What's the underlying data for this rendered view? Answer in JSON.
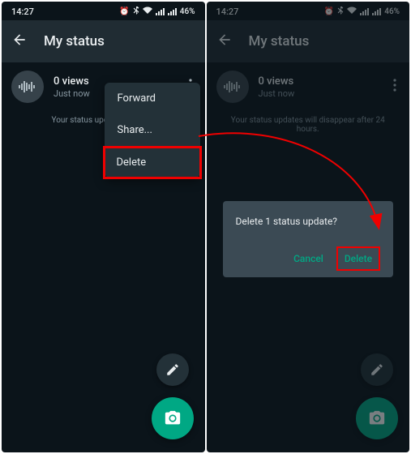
{
  "statusbar": {
    "time": "14:27",
    "battery": "46%"
  },
  "appbar": {
    "title": "My status"
  },
  "status": {
    "views": "0 views",
    "time": "Just now"
  },
  "hint_truncated": "Your status updates will disa",
  "hint_full": "Your status updates will disappear after 24 hours.",
  "menu": {
    "forward": "Forward",
    "share": "Share...",
    "delete": "Delete"
  },
  "dialog": {
    "message": "Delete 1 status update?",
    "cancel": "Cancel",
    "delete": "Delete"
  }
}
